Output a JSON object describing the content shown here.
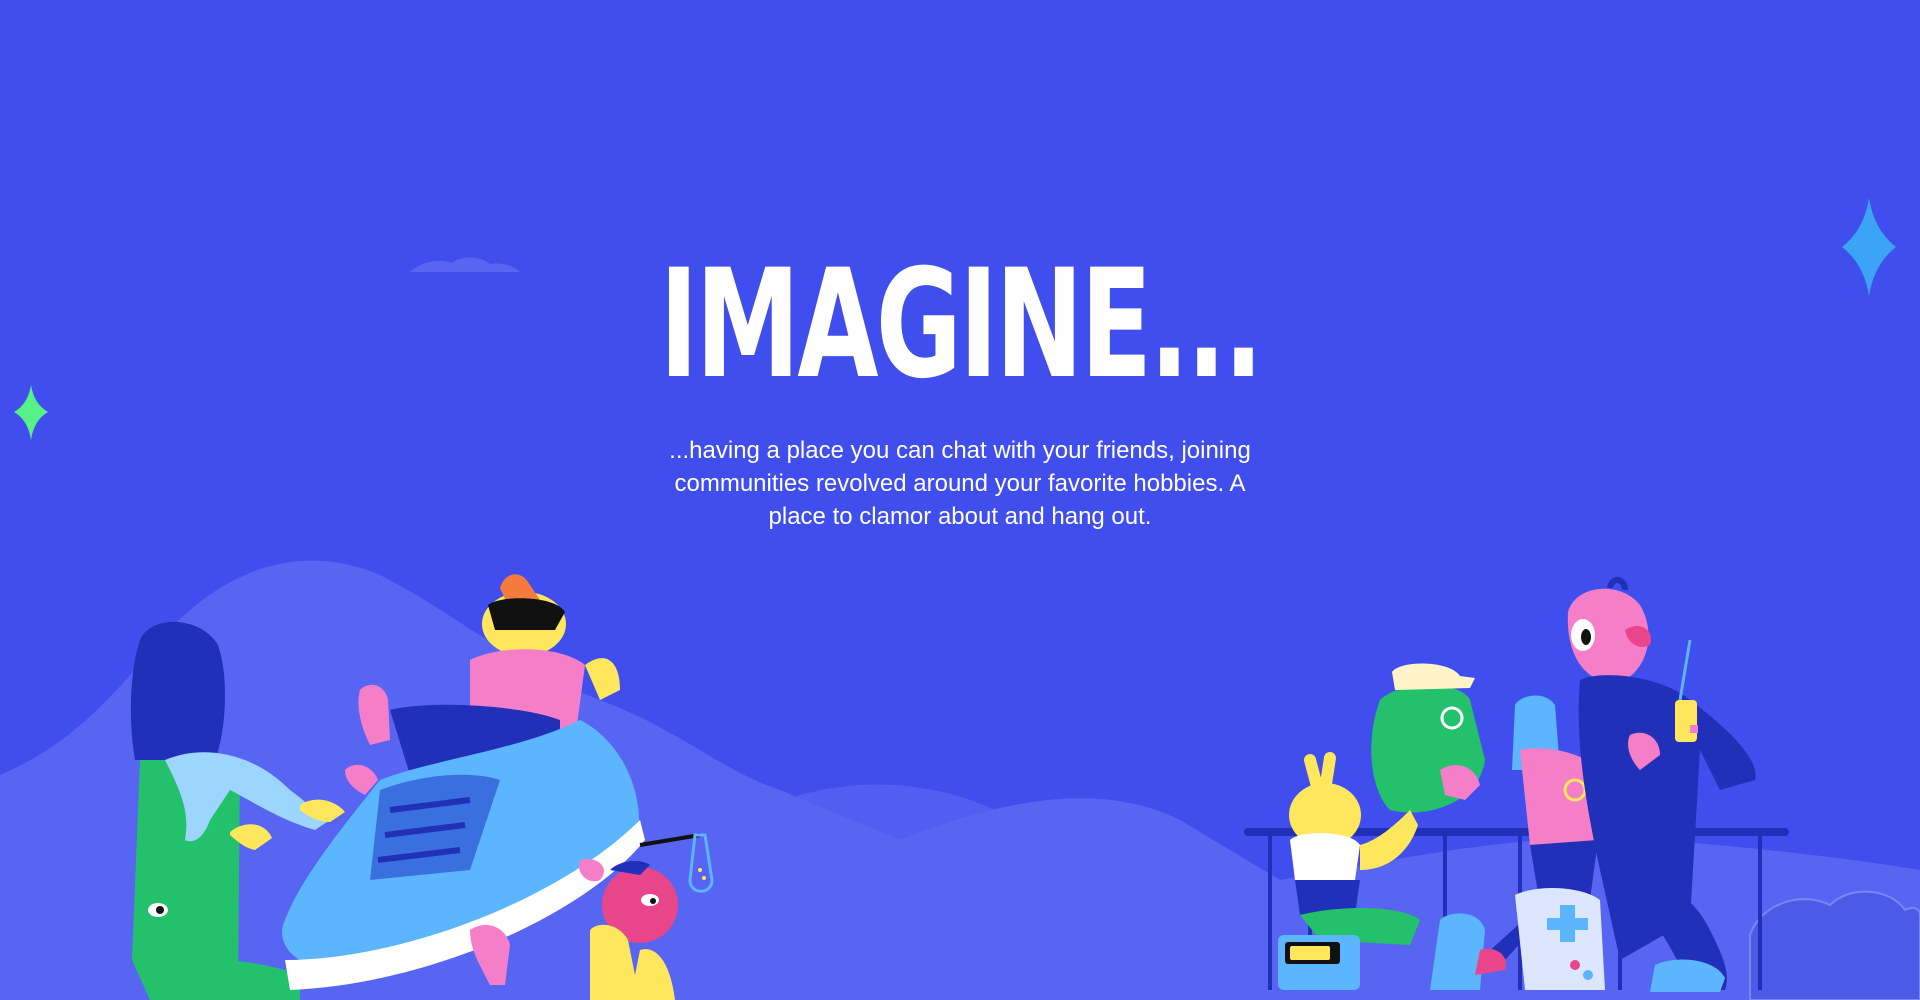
{
  "hero": {
    "title": "IMAGINE...",
    "description": "...having a place you can chat with your friends, joining communities revolved around your favorite hobbies. A place to clamor about and hang out."
  },
  "colors": {
    "background": "#404EED",
    "hills": "#5865F2",
    "sparkle_green": "#57F287",
    "sparkle_blue": "#3BA4F6",
    "character_pink": "#F47FC8",
    "character_yellow": "#FEE75C",
    "character_green": "#23C16B",
    "character_blue": "#5CB5FF",
    "character_navy": "#2030B8"
  },
  "illustrations": [
    "sparkle-green-icon",
    "sparkle-blue-icon",
    "cloud-icon",
    "hills-illustration",
    "left-characters-illustration",
    "right-characters-illustration"
  ]
}
